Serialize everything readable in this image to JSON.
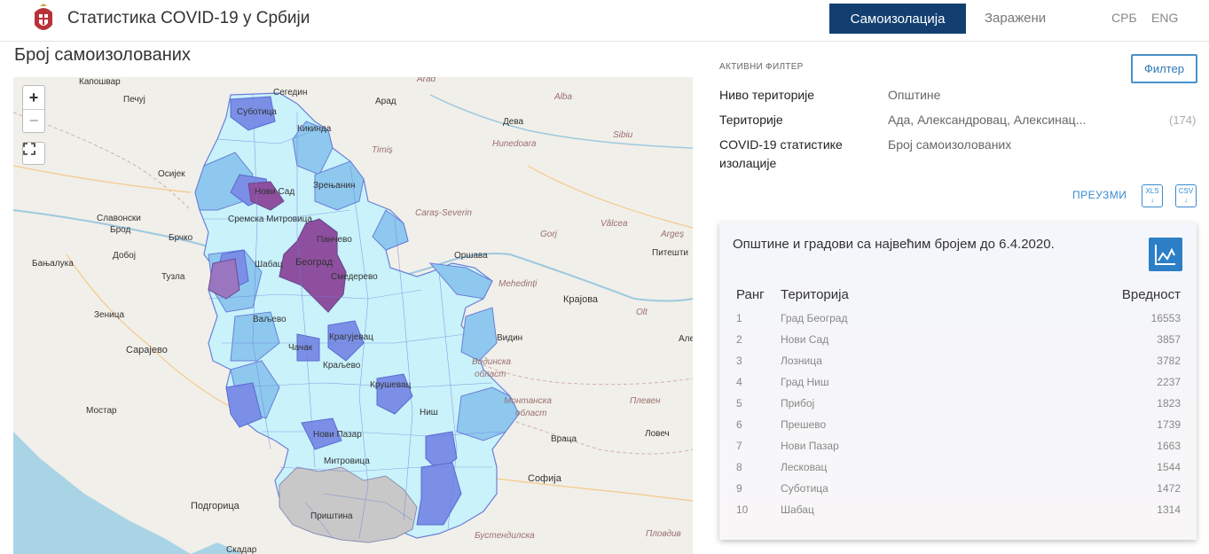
{
  "header": {
    "app_title": "Статистика COVID-19 у Србији",
    "nav": [
      {
        "label": "Самоизолација",
        "active": true
      },
      {
        "label": "Заражени",
        "active": false
      }
    ],
    "languages": [
      "СРБ",
      "ENG"
    ]
  },
  "page_title": "Број самоизолованих",
  "map": {
    "zoom_in": "+",
    "zoom_out": "−",
    "labels": {
      "kaposhvar": "Капошвар",
      "pecuj": "Печуј",
      "segedin": "Сегедин",
      "arad_lat": "Arad",
      "arad": "Арад",
      "alba": "Alba",
      "deva": "Дева",
      "hunedoara": "Hunedoara",
      "timis": "Timiș",
      "sibiu": "Sibiu",
      "osijek": "Осијек",
      "caras": "Caraș-Severin",
      "valcea": "Vâlcea",
      "gorj": "Gorj",
      "arges": "Argeș",
      "pitesti": "Питешти",
      "slavonski": "Славонски",
      "brod": "Брод",
      "brcko": "Брчко",
      "doboj": "Добој",
      "banjaluka": "Бањалука",
      "tuzla": "Тузла",
      "zenica": "Зеница",
      "sarajevo": "Сарајево",
      "mostar": "Мостар",
      "podgorica": "Подгорица",
      "skadar": "Скадар",
      "orsava": "Оршава",
      "mehedinti": "Mehedinți",
      "krajova": "Крајова",
      "olt": "Olt",
      "vidin": "Видин",
      "vidinska": "Видинска",
      "oblast": "област",
      "montanska": "Монтанска",
      "oblast2": "област",
      "pleven": "Плевен",
      "vraca": "Враца",
      "lovech": "Ловеч",
      "sofija": "Софија",
      "bustendil": "Бустендилска",
      "plovdiv": "Пловдив",
      "subotica": "Суботица",
      "novisad": "Нови Сад",
      "beograd": "Београд",
      "pancevo": "Панчево",
      "smederevo": "Смедерево",
      "sabac": "Шабац",
      "sremska": "Сремска Митровица",
      "valjevo": "Ваљево",
      "kragujevac": "Крагујевац",
      "kraljevo": "Краљево",
      "krusevac": "Крушевац",
      "nis": "Ниш",
      "novipazar": "Нови Пазар",
      "mitrovica": "Митровица",
      "pristina": "Приштина",
      "kikinda": "Кикинда",
      "zrenjanin": "Зрењанин",
      "cacak": "Чачак",
      "ale": "Але"
    }
  },
  "filters": {
    "active_label": "АКТИВНИ ФИЛТЕР",
    "button": "Филтер",
    "rows": [
      {
        "label": "Ниво територије",
        "value": "Општине",
        "count": ""
      },
      {
        "label": "Територије",
        "value": "Ада, Александровац, Алексинац...",
        "count": "(174)"
      },
      {
        "label": "COVID-19 статистике изолације",
        "value": "Број самоизолованих",
        "count": ""
      }
    ],
    "download": "ПРЕУЗМИ",
    "xls": "XLS",
    "csv": "CSV"
  },
  "card": {
    "title": "Општине и градови са највећим бројем до 6.4.2020.",
    "columns": {
      "rank": "Ранг",
      "territory": "Територија",
      "value": "Вредност"
    },
    "rows": [
      {
        "rank": "1",
        "territory": "Град Београд",
        "value": "16553"
      },
      {
        "rank": "2",
        "territory": "Нови Сад",
        "value": "3857"
      },
      {
        "rank": "3",
        "territory": "Лозница",
        "value": "3782"
      },
      {
        "rank": "4",
        "territory": "Град Ниш",
        "value": "2237"
      },
      {
        "rank": "5",
        "territory": "Прибој",
        "value": "1823"
      },
      {
        "rank": "6",
        "territory": "Прешево",
        "value": "1739"
      },
      {
        "rank": "7",
        "territory": "Нови Пазар",
        "value": "1663"
      },
      {
        "rank": "8",
        "territory": "Лесковац",
        "value": "1544"
      },
      {
        "rank": "9",
        "territory": "Суботица",
        "value": "1472"
      },
      {
        "rank": "10",
        "territory": "Шабац",
        "value": "1314"
      }
    ]
  },
  "colors": {
    "nav_active": "#123f70",
    "accent": "#2c7fc7",
    "light": "#c9f2fb",
    "mid": "#8ec8ee",
    "high": "#7b8fe6",
    "top": "#8e4f9e",
    "nodata": "#c8c8c8"
  }
}
